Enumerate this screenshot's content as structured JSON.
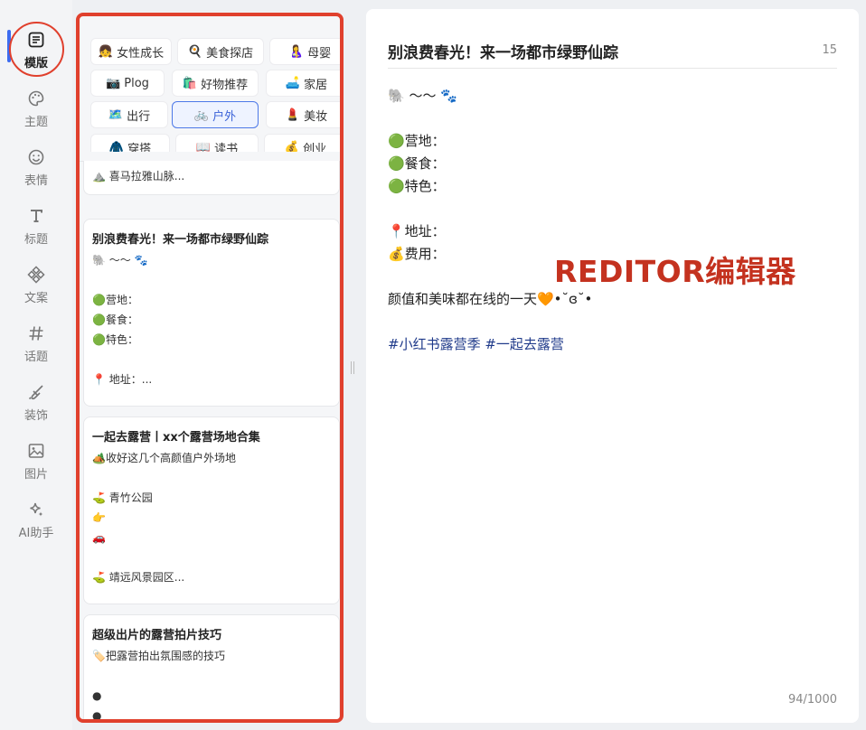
{
  "rail": {
    "items": [
      {
        "label": "模版",
        "icon": "template-icon",
        "active": true
      },
      {
        "label": "主题",
        "icon": "palette-icon"
      },
      {
        "label": "表情",
        "icon": "smile-icon"
      },
      {
        "label": "标题",
        "icon": "title-t-icon"
      },
      {
        "label": "文案",
        "icon": "copywriting-icon"
      },
      {
        "label": "话题",
        "icon": "hashtag-icon"
      },
      {
        "label": "装饰",
        "icon": "brush-icon"
      },
      {
        "label": "图片",
        "icon": "image-icon"
      },
      {
        "label": "AI助手",
        "icon": "sparkle-icon"
      }
    ],
    "accent": "#3d6cf0"
  },
  "categories": [
    {
      "emoji": "👧",
      "label": "女性成长"
    },
    {
      "emoji": "🍳",
      "label": "美食探店"
    },
    {
      "emoji": "🤱",
      "label": "母婴"
    },
    {
      "emoji": "📷",
      "label": "Plog"
    },
    {
      "emoji": "🛍️",
      "label": "好物推荐"
    },
    {
      "emoji": "🛋️",
      "label": "家居"
    },
    {
      "emoji": "🗺️",
      "label": "出行"
    },
    {
      "emoji": "🚲",
      "label": "户外",
      "selected": true
    },
    {
      "emoji": "💄",
      "label": "美妆"
    },
    {
      "emoji": "🧥",
      "label": "穿搭"
    },
    {
      "emoji": "📖",
      "label": "读书"
    },
    {
      "emoji": "💰",
      "label": "创业"
    }
  ],
  "cards": [
    {
      "lines": [
        "⛰️ 喜马拉雅山脉..."
      ]
    },
    {
      "title": "别浪费春光！来一场都市绿野仙踪",
      "lines": [
        "🐘 ～～ 🐾",
        "",
        "🟢营地：",
        "🟢餐食：",
        "🟢特色：",
        "",
        "📍 地址：..."
      ]
    },
    {
      "title": "一起去露营丨xx个露营场地合集",
      "lines": [
        "🏕️收好这几个高颜值户外场地",
        "",
        "⛳ 青竹公园",
        "👉",
        "🚗",
        "",
        "⛳ 靖远风景园区..."
      ]
    },
    {
      "title": "超级出片的露营拍片技巧",
      "lines": [
        "🏷️把露营拍出氛围感的技巧",
        "",
        "●",
        "●"
      ]
    }
  ],
  "editor": {
    "title": "别浪费春光！来一场都市绿野仙踪",
    "title_count": "15",
    "lines": [
      "🐘 ～～ 🐾",
      "",
      "🟢营地：",
      "🟢餐食：",
      "🟢特色：",
      "",
      "📍地址：",
      "💰费用：",
      "",
      "颜值和美味都在线的一天🧡•˘ɞ˘•",
      ""
    ],
    "tags": "#小红书露营季 #一起去露营",
    "watermark": "REDITOR编辑器",
    "char_count": "94/1000"
  },
  "colors": {
    "highlight": "#e0402d",
    "selected": "#4d79e8",
    "tag": "#1f3a8a"
  }
}
